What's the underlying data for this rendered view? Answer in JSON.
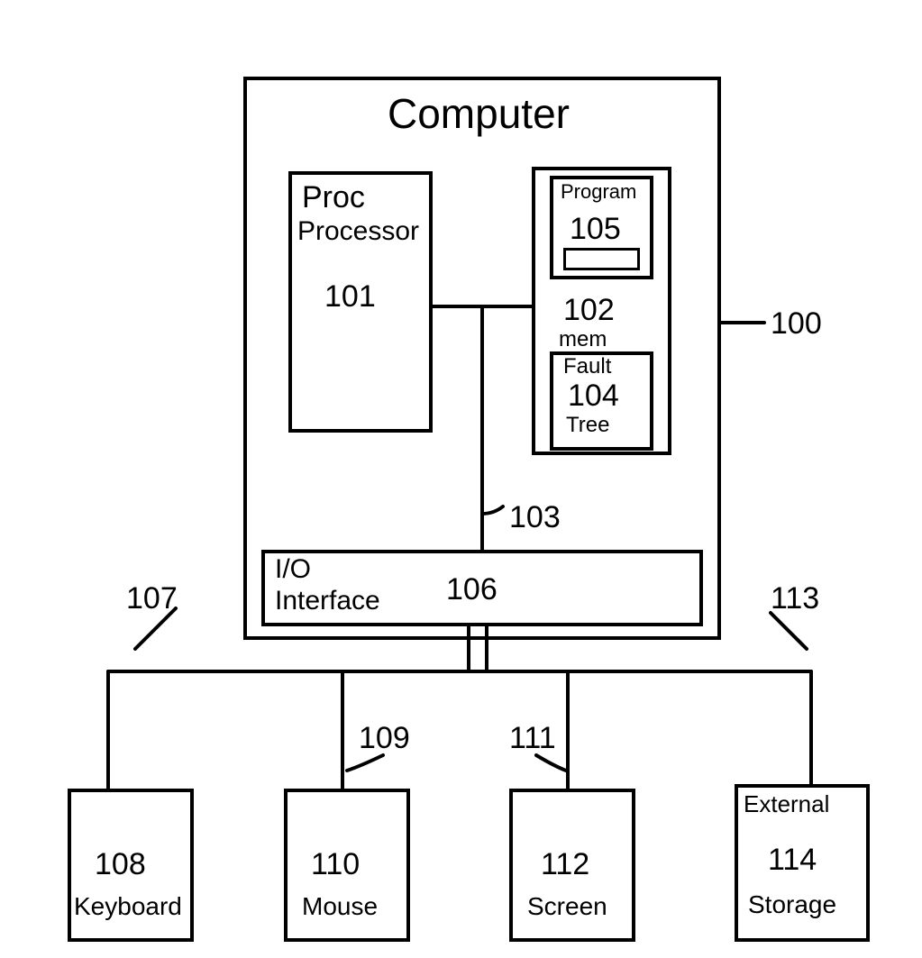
{
  "title": "Computer",
  "computer": {
    "ref": "100",
    "processor": {
      "label_top": "Proc",
      "label_bottom": "Processor",
      "ref": "101"
    },
    "memory": {
      "ref": "102",
      "label": "mem",
      "program": {
        "label": "Program",
        "ref": "105"
      },
      "fault_tree": {
        "label_top": "Fault",
        "ref": "104",
        "label_bottom": "Tree"
      }
    },
    "bus_ref": "103",
    "io": {
      "label_top": "I/O",
      "label_bottom": "Interface",
      "ref": "106"
    }
  },
  "conn_refs": {
    "kb": "107",
    "mouse": "109",
    "screen": "111",
    "storage": "113"
  },
  "peripherals": {
    "keyboard": {
      "ref": "108",
      "label": "Keyboard"
    },
    "mouse": {
      "ref": "110",
      "label": "Mouse"
    },
    "screen": {
      "ref": "112",
      "label": "Screen"
    },
    "storage": {
      "ref": "114",
      "label_top": "External",
      "label_bottom": "Storage"
    }
  }
}
